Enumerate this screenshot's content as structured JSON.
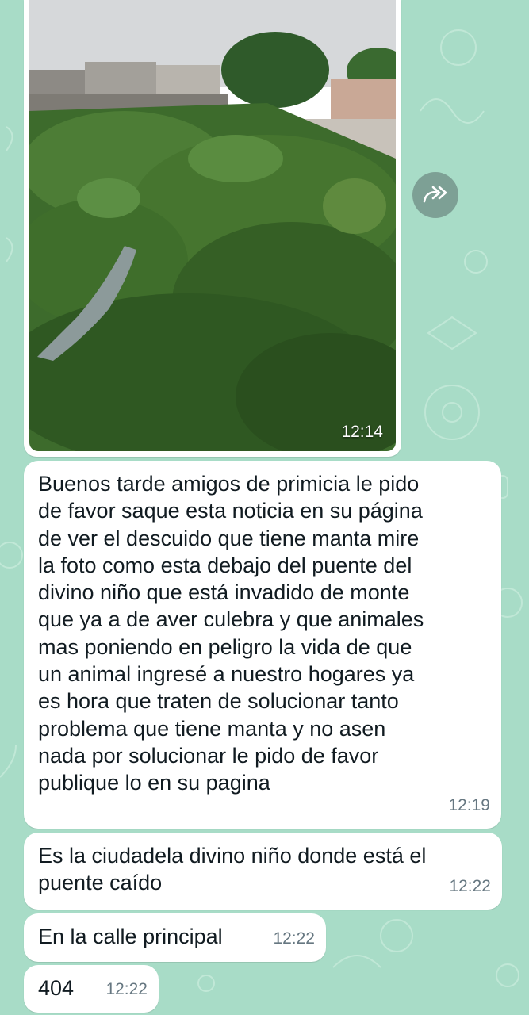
{
  "messages": [
    {
      "type": "image",
      "time": "12:14"
    },
    {
      "type": "text",
      "text": "Buenos tarde amigos de primicia le pido\nde favor saque esta noticia en su página\nde ver el descuido que tiene manta mire\nla foto como esta debajo del puente del\ndivino niño que está invadido de monte\nque ya a de aver culebra y que animales\nmas poniendo en peligro la vida de que\nun animal ingresé a nuestro hogares ya\nes hora que traten de solucionar tanto\nproblema que tiene manta y no asen\nnada por solucionar le pido de favor\npublique lo en su pagina",
      "time": "12:19"
    },
    {
      "type": "text",
      "text": "Es la ciudadela divino niño donde está el\npuente caído",
      "time": "12:22"
    },
    {
      "type": "text",
      "text": "En la calle principal",
      "time": "12:22"
    },
    {
      "type": "text",
      "text": "404",
      "time": "12:22"
    }
  ],
  "icons": {
    "forward": "forward-icon"
  },
  "colors": {
    "wallpaper": "#a8dcc7",
    "bubble": "#ffffff",
    "timestamp": "#667781",
    "text": "#111b21"
  }
}
